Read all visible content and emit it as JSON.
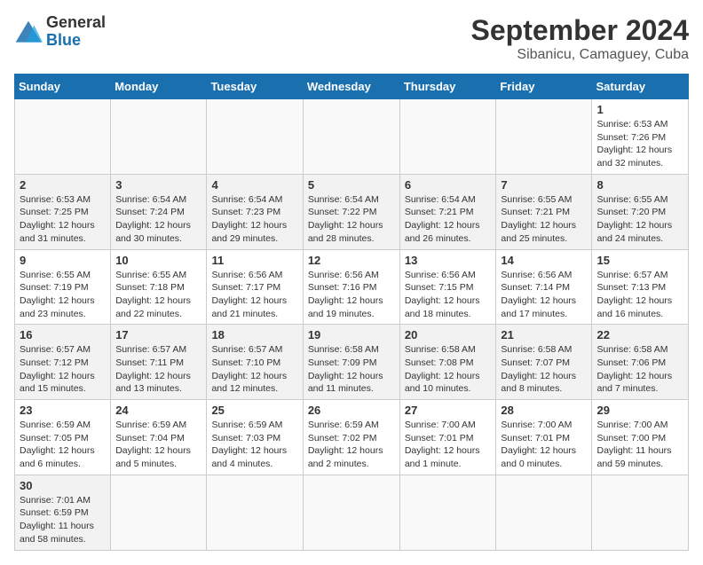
{
  "header": {
    "logo": {
      "general": "General",
      "blue": "Blue"
    },
    "title": "September 2024",
    "subtitle": "Sibanicu, Camaguey, Cuba"
  },
  "calendar": {
    "days_of_week": [
      "Sunday",
      "Monday",
      "Tuesday",
      "Wednesday",
      "Thursday",
      "Friday",
      "Saturday"
    ],
    "weeks": [
      [
        {
          "day": "",
          "info": ""
        },
        {
          "day": "",
          "info": ""
        },
        {
          "day": "",
          "info": ""
        },
        {
          "day": "",
          "info": ""
        },
        {
          "day": "",
          "info": ""
        },
        {
          "day": "",
          "info": ""
        },
        {
          "day": "1",
          "info": "Sunrise: 6:53 AM\nSunset: 7:26 PM\nDaylight: 12 hours\nand 32 minutes."
        }
      ],
      [
        {
          "day": "2",
          "info": "Sunrise: 6:53 AM\nSunset: 7:25 PM\nDaylight: 12 hours\nand 31 minutes."
        },
        {
          "day": "3",
          "info": "Sunrise: 6:54 AM\nSunset: 7:24 PM\nDaylight: 12 hours\nand 30 minutes."
        },
        {
          "day": "4",
          "info": "Sunrise: 6:54 AM\nSunset: 7:23 PM\nDaylight: 12 hours\nand 29 minutes."
        },
        {
          "day": "5",
          "info": "Sunrise: 6:54 AM\nSunset: 7:22 PM\nDaylight: 12 hours\nand 28 minutes."
        },
        {
          "day": "6",
          "info": "Sunrise: 6:54 AM\nSunset: 7:21 PM\nDaylight: 12 hours\nand 26 minutes."
        },
        {
          "day": "7",
          "info": "Sunrise: 6:55 AM\nSunset: 7:21 PM\nDaylight: 12 hours\nand 25 minutes."
        },
        {
          "day": "8",
          "info": "Sunrise: 6:55 AM\nSunset: 7:20 PM\nDaylight: 12 hours\nand 24 minutes."
        }
      ],
      [
        {
          "day": "9",
          "info": "Sunrise: 6:55 AM\nSunset: 7:19 PM\nDaylight: 12 hours\nand 23 minutes."
        },
        {
          "day": "10",
          "info": "Sunrise: 6:55 AM\nSunset: 7:18 PM\nDaylight: 12 hours\nand 22 minutes."
        },
        {
          "day": "11",
          "info": "Sunrise: 6:56 AM\nSunset: 7:17 PM\nDaylight: 12 hours\nand 21 minutes."
        },
        {
          "day": "12",
          "info": "Sunrise: 6:56 AM\nSunset: 7:16 PM\nDaylight: 12 hours\nand 19 minutes."
        },
        {
          "day": "13",
          "info": "Sunrise: 6:56 AM\nSunset: 7:15 PM\nDaylight: 12 hours\nand 18 minutes."
        },
        {
          "day": "14",
          "info": "Sunrise: 6:56 AM\nSunset: 7:14 PM\nDaylight: 12 hours\nand 17 minutes."
        },
        {
          "day": "15",
          "info": "Sunrise: 6:57 AM\nSunset: 7:13 PM\nDaylight: 12 hours\nand 16 minutes."
        }
      ],
      [
        {
          "day": "16",
          "info": "Sunrise: 6:57 AM\nSunset: 7:12 PM\nDaylight: 12 hours\nand 15 minutes."
        },
        {
          "day": "17",
          "info": "Sunrise: 6:57 AM\nSunset: 7:11 PM\nDaylight: 12 hours\nand 13 minutes."
        },
        {
          "day": "18",
          "info": "Sunrise: 6:57 AM\nSunset: 7:10 PM\nDaylight: 12 hours\nand 12 minutes."
        },
        {
          "day": "19",
          "info": "Sunrise: 6:58 AM\nSunset: 7:09 PM\nDaylight: 12 hours\nand 11 minutes."
        },
        {
          "day": "20",
          "info": "Sunrise: 6:58 AM\nSunset: 7:08 PM\nDaylight: 12 hours\nand 10 minutes."
        },
        {
          "day": "21",
          "info": "Sunrise: 6:58 AM\nSunset: 7:07 PM\nDaylight: 12 hours\nand 8 minutes."
        },
        {
          "day": "22",
          "info": "Sunrise: 6:58 AM\nSunset: 7:06 PM\nDaylight: 12 hours\nand 7 minutes."
        }
      ],
      [
        {
          "day": "23",
          "info": "Sunrise: 6:59 AM\nSunset: 7:05 PM\nDaylight: 12 hours\nand 6 minutes."
        },
        {
          "day": "24",
          "info": "Sunrise: 6:59 AM\nSunset: 7:04 PM\nDaylight: 12 hours\nand 5 minutes."
        },
        {
          "day": "25",
          "info": "Sunrise: 6:59 AM\nSunset: 7:03 PM\nDaylight: 12 hours\nand 4 minutes."
        },
        {
          "day": "26",
          "info": "Sunrise: 6:59 AM\nSunset: 7:02 PM\nDaylight: 12 hours\nand 2 minutes."
        },
        {
          "day": "27",
          "info": "Sunrise: 7:00 AM\nSunset: 7:01 PM\nDaylight: 12 hours\nand 1 minute."
        },
        {
          "day": "28",
          "info": "Sunrise: 7:00 AM\nSunset: 7:01 PM\nDaylight: 12 hours\nand 0 minutes."
        },
        {
          "day": "29",
          "info": "Sunrise: 7:00 AM\nSunset: 7:00 PM\nDaylight: 11 hours\nand 59 minutes."
        }
      ],
      [
        {
          "day": "30",
          "info": "Sunrise: 7:01 AM\nSunset: 6:59 PM\nDaylight: 11 hours\nand 58 minutes."
        },
        {
          "day": "",
          "info": ""
        },
        {
          "day": "",
          "info": ""
        },
        {
          "day": "",
          "info": ""
        },
        {
          "day": "",
          "info": ""
        },
        {
          "day": "",
          "info": ""
        },
        {
          "day": "",
          "info": ""
        }
      ]
    ]
  }
}
